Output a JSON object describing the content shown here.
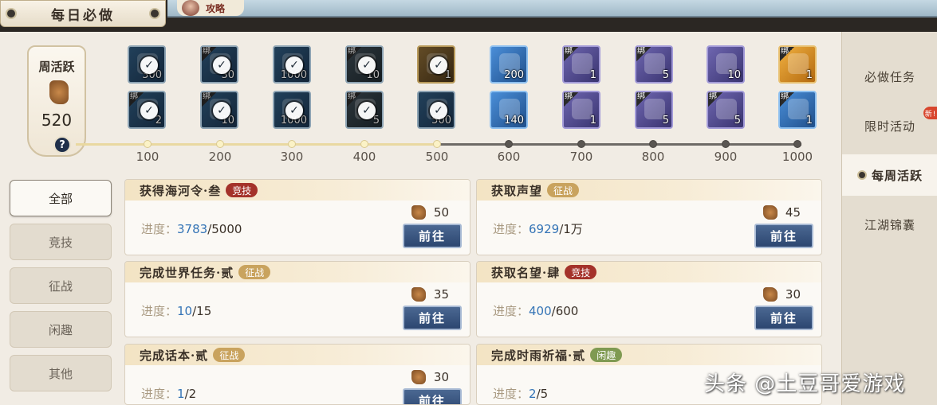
{
  "header": {
    "title": "每日必做",
    "guide_label": "攻略"
  },
  "right_tabs": [
    {
      "label": "必做任务",
      "active": false
    },
    {
      "label": "限时活动",
      "active": false,
      "badge": "新!"
    },
    {
      "label": "每周活跃",
      "active": true
    },
    {
      "label": "江湖锦囊",
      "active": false
    }
  ],
  "weekly": {
    "title": "周活跃",
    "value": "520",
    "help": "?"
  },
  "milestones": [
    "100",
    "200",
    "300",
    "400",
    "500",
    "600",
    "700",
    "800",
    "900",
    "1000"
  ],
  "completed_milestones": 5,
  "rewards_top": [
    {
      "qty": "300",
      "bound": false,
      "done": true,
      "style": "c-blue",
      "icon": "jade-icon"
    },
    {
      "qty": "30",
      "bound": true,
      "done": true,
      "style": "c-blue",
      "icon": "bag-icon"
    },
    {
      "qty": "1000",
      "bound": false,
      "done": true,
      "style": "c-blue",
      "icon": "coin-icon"
    },
    {
      "qty": "10",
      "bound": true,
      "done": true,
      "style": "c-dark",
      "icon": "book-icon"
    },
    {
      "qty": "1",
      "bound": false,
      "done": true,
      "style": "c-gold",
      "icon": "chest-icon"
    },
    {
      "qty": "200",
      "bound": false,
      "done": false,
      "style": "c-bright",
      "icon": "gold-figure-icon"
    },
    {
      "qty": "1",
      "bound": true,
      "done": false,
      "style": "c-purple",
      "icon": "silver-ingot-icon"
    },
    {
      "qty": "5",
      "bound": true,
      "done": false,
      "style": "c-purple",
      "icon": "treasure-box-icon"
    },
    {
      "qty": "10",
      "bound": false,
      "done": false,
      "style": "c-purple",
      "icon": "scroll-icon"
    },
    {
      "qty": "1",
      "bound": true,
      "done": false,
      "style": "c-orange",
      "icon": "gold-card-icon"
    }
  ],
  "rewards_bottom": [
    {
      "qty": "2",
      "bound": true,
      "done": true,
      "style": "c-blue",
      "icon": "pouch-icon"
    },
    {
      "qty": "10",
      "bound": true,
      "done": true,
      "style": "c-blue",
      "icon": "bag-icon"
    },
    {
      "qty": "1000",
      "bound": false,
      "done": true,
      "style": "c-blue",
      "icon": "coin-icon"
    },
    {
      "qty": "5",
      "bound": true,
      "done": true,
      "style": "c-dark",
      "icon": "orb-icon"
    },
    {
      "qty": "500",
      "bound": false,
      "done": true,
      "style": "c-blue",
      "icon": "coin-bag-icon"
    },
    {
      "qty": "140",
      "bound": false,
      "done": false,
      "style": "c-bright",
      "icon": "silver-bar-icon"
    },
    {
      "qty": "1",
      "bound": true,
      "done": false,
      "style": "c-purple",
      "icon": "pouch-icon"
    },
    {
      "qty": "5",
      "bound": true,
      "done": false,
      "style": "c-purple",
      "icon": "pearl-icon"
    },
    {
      "qty": "5",
      "bound": true,
      "done": false,
      "style": "c-purple",
      "icon": "letters-icon"
    },
    {
      "qty": "1",
      "bound": true,
      "done": false,
      "style": "c-bright",
      "icon": "ticket-icon"
    }
  ],
  "bind_label": "绑",
  "filters": [
    {
      "label": "全部",
      "active": true
    },
    {
      "label": "竞技",
      "active": false
    },
    {
      "label": "征战",
      "active": false
    },
    {
      "label": "闲趣",
      "active": false
    },
    {
      "label": "其他",
      "active": false
    }
  ],
  "progress_prefix": "进度：",
  "go_label": "前往",
  "tasks": [
    {
      "name": "获得海河令·叁",
      "tag": "竞技",
      "tag_color": "red",
      "current": "3783",
      "total": "/5000",
      "points": "50"
    },
    {
      "name": "获取声望",
      "tag": "征战",
      "tag_color": "gold",
      "current": "6929",
      "total": "/1万",
      "points": "45"
    },
    {
      "name": "完成世界任务·贰",
      "tag": "征战",
      "tag_color": "gold",
      "current": "10",
      "total": "/15",
      "points": "35"
    },
    {
      "name": "获取名望·肆",
      "tag": "竞技",
      "tag_color": "red",
      "current": "400",
      "total": "/600",
      "points": "30"
    },
    {
      "name": "完成话本·贰",
      "tag": "征战",
      "tag_color": "gold",
      "current": "1",
      "total": "/2",
      "points": "30"
    },
    {
      "name": "完成时雨祈福·贰",
      "tag": "闲趣",
      "tag_color": "green",
      "current": "2",
      "total": "/5",
      "points": ""
    }
  ],
  "watermark": "头条 @土豆哥爱游戏"
}
